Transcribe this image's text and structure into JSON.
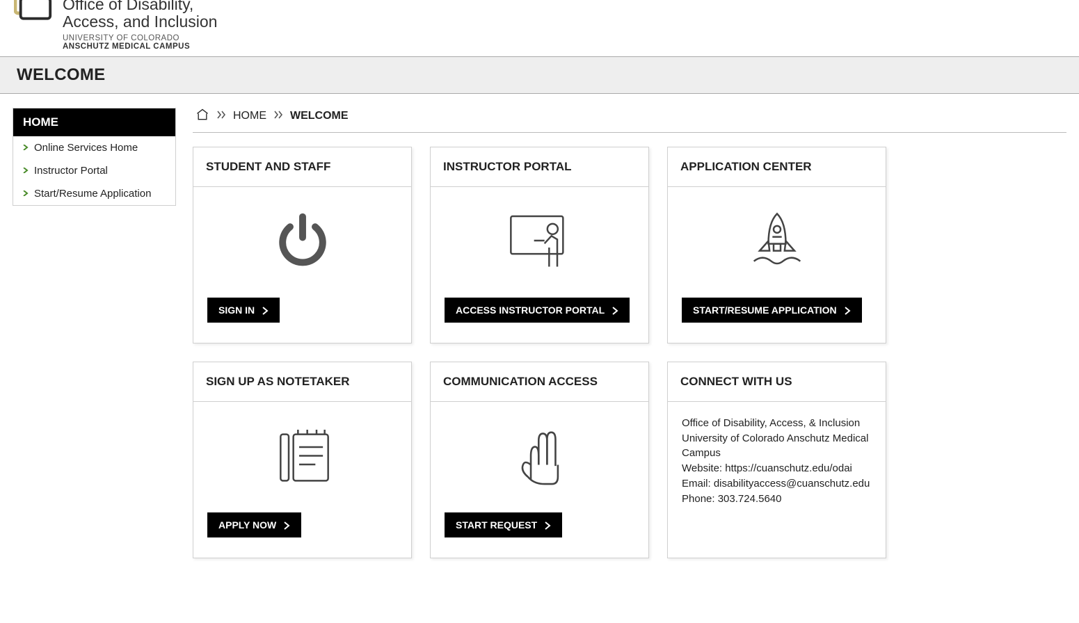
{
  "header": {
    "dept_line1": "Office of Disability,",
    "dept_line2": "Access, and Inclusion",
    "uni": "UNIVERSITY OF COLORADO",
    "campus": "ANSCHUTZ MEDICAL CAMPUS"
  },
  "welcome_bar": "WELCOME",
  "breadcrumb": {
    "home": "HOME",
    "current": "WELCOME"
  },
  "sidebar": {
    "head": "HOME",
    "items": [
      {
        "label": "Online Services Home"
      },
      {
        "label": "Instructor Portal"
      },
      {
        "label": "Start/Resume Application"
      }
    ]
  },
  "cards": {
    "student": {
      "title": "STUDENT AND STAFF",
      "button": "SIGN IN"
    },
    "instructor": {
      "title": "INSTRUCTOR PORTAL",
      "button": "ACCESS INSTRUCTOR PORTAL"
    },
    "application": {
      "title": "APPLICATION CENTER",
      "button": "START/RESUME APPLICATION"
    },
    "notetaker": {
      "title": "SIGN UP AS NOTETAKER",
      "button": "APPLY NOW"
    },
    "communication": {
      "title": "COMMUNICATION ACCESS",
      "button": "START REQUEST"
    },
    "connect": {
      "title": "CONNECT WITH US",
      "line1": "Office of Disability, Access, & Inclusion",
      "line2": "University of Colorado Anschutz Medical Campus",
      "website_label": "Website: ",
      "website": "https://cuanschutz.edu/odai",
      "email_label": "Email: ",
      "email": "disabilityaccess@cuanschutz.edu",
      "phone_label": "Phone: ",
      "phone": "303.724.5640"
    }
  }
}
